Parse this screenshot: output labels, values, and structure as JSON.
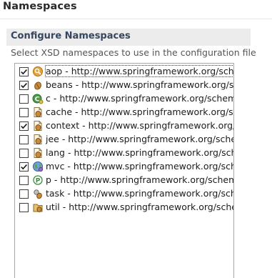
{
  "page": {
    "title": "Namespaces"
  },
  "section": {
    "title": "Configure Namespaces",
    "description": "Select XSD namespaces to use in the configuration file"
  },
  "namespaces": [
    {
      "label": "aop - http://www.springframework.org/schema/aop",
      "checked": true,
      "icon": "aop-icon",
      "focused": true
    },
    {
      "label": "beans - http://www.springframework.org/schema/beans",
      "checked": true,
      "icon": "bean-icon"
    },
    {
      "label": "c - http://www.springframework.org/schema/c",
      "checked": false,
      "icon": "c-namespace-icon"
    },
    {
      "label": "cache - http://www.springframework.org/schema/cache",
      "checked": false,
      "icon": "cache-icon"
    },
    {
      "label": "context - http://www.springframework.org/schema/context",
      "checked": true,
      "icon": "context-icon"
    },
    {
      "label": "jee - http://www.springframework.org/schema/jee",
      "checked": false,
      "icon": "jee-icon"
    },
    {
      "label": "lang - http://www.springframework.org/schema/lang",
      "checked": false,
      "icon": "lang-icon"
    },
    {
      "label": "mvc - http://www.springframework.org/schema/mvc",
      "checked": true,
      "icon": "mvc-globe-icon"
    },
    {
      "label": "p - http://www.springframework.org/schema/p",
      "checked": false,
      "icon": "p-namespace-icon"
    },
    {
      "label": "task - http://www.springframework.org/schema/task",
      "checked": false,
      "icon": "task-icon"
    },
    {
      "label": "util - http://www.springframework.org/schema/util",
      "checked": false,
      "icon": "util-icon"
    }
  ]
}
